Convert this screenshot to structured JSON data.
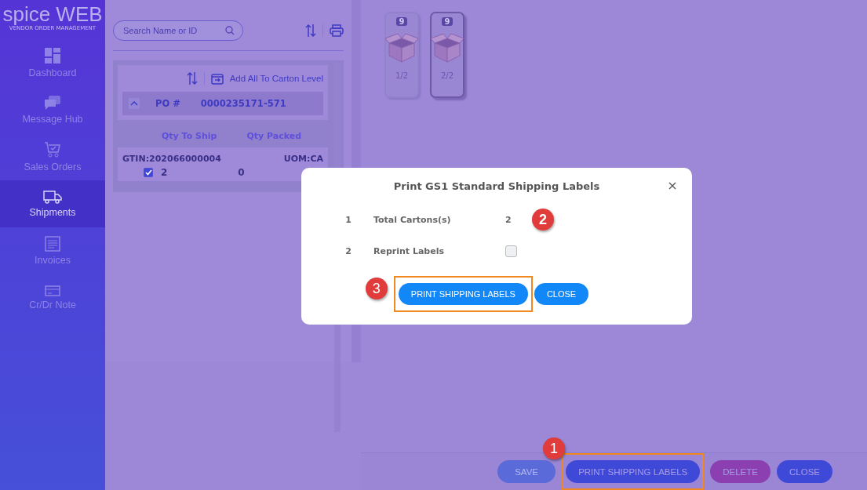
{
  "logo": {
    "word1": "spice",
    "word2": "WEB",
    "tagline": "VENDOR ORDER MANAGEMENT"
  },
  "sidebar": {
    "items": [
      {
        "label": "Dashboard",
        "selected": false
      },
      {
        "label": "Message Hub",
        "selected": false
      },
      {
        "label": "Sales Orders",
        "selected": false
      },
      {
        "label": "Shipments",
        "selected": true
      },
      {
        "label": "Invoices",
        "selected": false
      },
      {
        "label": "Cr/Dr Note",
        "selected": false
      }
    ]
  },
  "search": {
    "placeholder": "Search Name or ID"
  },
  "po_panel": {
    "add_all": "Add All To Carton Level",
    "po_label": "PO #",
    "po_number": "0000235171-571",
    "expanded": true,
    "columns": [
      "Qty To Ship",
      "Qty Packed"
    ],
    "items": [
      {
        "gtin": "GTIN:202066000004",
        "uom": "UOM:CA",
        "checked": true,
        "qty_to_ship": "2",
        "qty_packed": "0"
      }
    ]
  },
  "cartons": [
    {
      "badge": "9",
      "label": "1/2",
      "selected": false
    },
    {
      "badge": "9",
      "label": "2/2",
      "selected": true
    }
  ],
  "footer_buttons": [
    {
      "label": "SAVE",
      "kind": "save",
      "disabled": true
    },
    {
      "label": "PRINT SHIPPING LABELS",
      "kind": "primary",
      "disabled": false,
      "highlighted": true,
      "callout": "1"
    },
    {
      "label": "DELETE",
      "kind": "danger",
      "disabled": false
    },
    {
      "label": "CLOSE",
      "kind": "primary",
      "disabled": false
    }
  ],
  "dialog": {
    "title": "Print GS1 Standard Shipping Labels",
    "rows": [
      {
        "number": "1",
        "label": "Total Cartons(s)",
        "kind": "value",
        "value": "2",
        "callout": "2"
      },
      {
        "number": "2",
        "label": "Reprint Labels",
        "kind": "checkbox",
        "checked": false
      }
    ],
    "buttons": [
      {
        "label": "PRINT SHIPPING LABELS",
        "highlighted": true,
        "callout": "3"
      },
      {
        "label": "CLOSE"
      }
    ]
  }
}
